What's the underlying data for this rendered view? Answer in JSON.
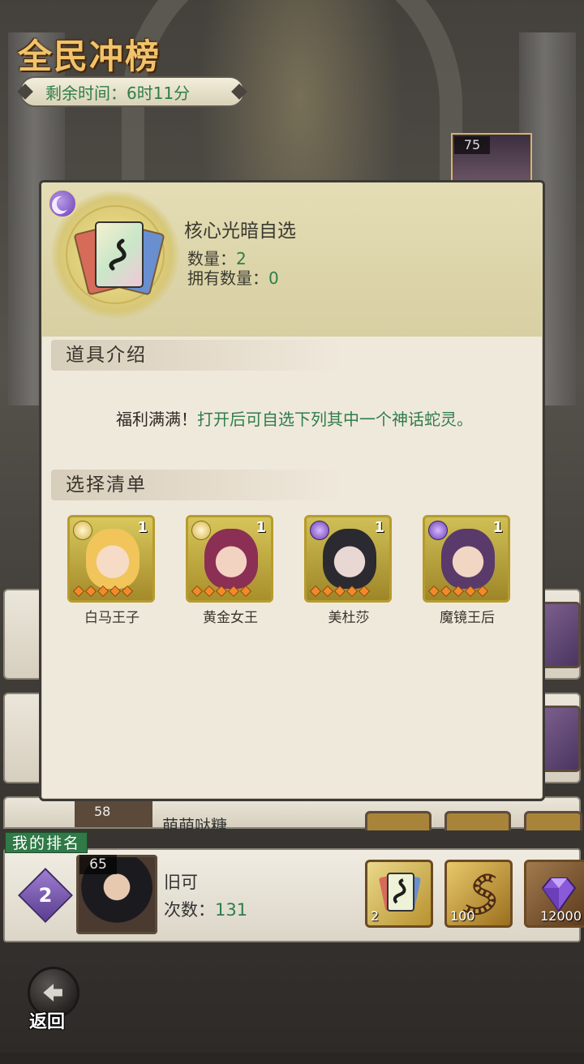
{
  "event": {
    "title": "全民冲榜",
    "timer_label": "剩余时间：",
    "timer_value": "6时11分"
  },
  "background": {
    "featured_level": "75"
  },
  "item_popup": {
    "element_icon": "dark-moon-icon",
    "item_name": "核心光暗自选",
    "quantity_label": "数量：",
    "quantity_value": "2",
    "owned_label": "拥有数量：",
    "owned_value": "0",
    "section_intro_title": "道具介绍",
    "description_prefix": "福利满满！",
    "description_highlight": "打开后可自选下列其中一个神话蛇灵。",
    "section_choices_title": "选择清单",
    "choices": [
      {
        "name": "白马王子",
        "count": "1",
        "element": "light",
        "border_color": "#b79b2e"
      },
      {
        "name": "黄金女王",
        "count": "1",
        "element": "light",
        "border_color": "#b79b2e"
      },
      {
        "name": "美杜莎",
        "count": "1",
        "element": "dark",
        "border_color": "#b79b2e"
      },
      {
        "name": "魔镜王后",
        "count": "1",
        "element": "dark",
        "border_color": "#b79b2e"
      }
    ]
  },
  "ranking_partial": {
    "level": "58",
    "name_fragment": "萌萌哒糖"
  },
  "my_rank": {
    "label": "我的排名",
    "rank": "2",
    "level": "65",
    "player_name": "旧可",
    "count_label": "次数：",
    "count_value": "131",
    "rewards": [
      {
        "icon": "snake-card-icon",
        "amount": "2"
      },
      {
        "icon": "snake-coil-icon",
        "amount": "100"
      },
      {
        "icon": "diamond-icon",
        "amount": "12000"
      }
    ]
  },
  "navigation": {
    "back_label": "返回"
  },
  "colors": {
    "accent_green": "#2f7d4a",
    "title_gold": "#f1c36a",
    "frame_gold": "#b79b2e",
    "panel_bg": "#efe9dc"
  }
}
